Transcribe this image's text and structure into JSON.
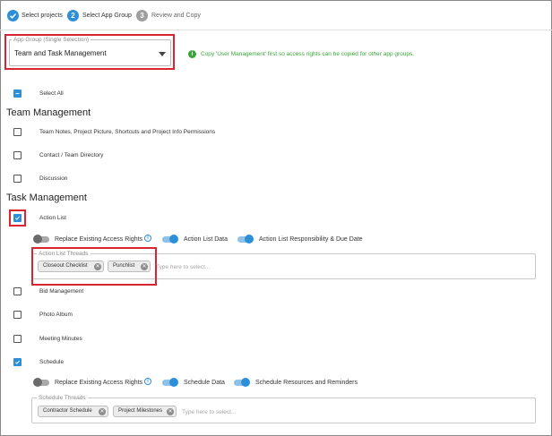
{
  "stepper": {
    "steps": [
      {
        "number": "1",
        "label": "Select projects",
        "state": "completed"
      },
      {
        "number": "2",
        "label": "Select App Group",
        "state": "active"
      },
      {
        "number": "3",
        "label": "Review and Copy",
        "state": "pending"
      }
    ]
  },
  "app_group": {
    "legend": "App Group (Single Selection)",
    "value": "Team and Task Management",
    "info_text": "Copy 'User Management' first so access rights can be copied for other app groups."
  },
  "select_all": {
    "label": "Select All",
    "state": "indeterminate"
  },
  "team_management": {
    "title": "Team Management",
    "items": [
      {
        "label": "Team Notes, Project Picture, Shortcuts and Project Info Permissions",
        "checked": false
      },
      {
        "label": "Contact / Team Directory",
        "checked": false
      },
      {
        "label": "Discussion",
        "checked": false
      }
    ]
  },
  "task_management": {
    "title": "Task Management",
    "action_list": {
      "label": "Action List",
      "checked": true,
      "options": [
        {
          "label": "Replace Existing Access Rights",
          "on": false,
          "has_info": true
        },
        {
          "label": "Action List Data",
          "on": true
        },
        {
          "label": "Action List Responsibility & Due Date",
          "on": true
        }
      ],
      "threads": {
        "legend": "Action List Threads",
        "chips": [
          "Closeout Checklist",
          "Punchlist"
        ],
        "placeholder": "Type here to select..."
      }
    },
    "items": [
      {
        "label": "Bid Management",
        "checked": false
      },
      {
        "label": "Photo Album",
        "checked": false
      },
      {
        "label": "Meeting Minutes",
        "checked": false
      }
    ],
    "schedule": {
      "label": "Schedule",
      "checked": true,
      "options": [
        {
          "label": "Replace Existing Access Rights",
          "on": false,
          "has_info": true
        },
        {
          "label": "Schedule Data",
          "on": true
        },
        {
          "label": "Schedule Resources and Reminders",
          "on": true
        }
      ],
      "threads": {
        "legend": "Schedule Threads",
        "chips": [
          "Contractor Schedule",
          "Project Milestones"
        ],
        "placeholder": "Type here to select..."
      }
    }
  },
  "colors": {
    "accent": "#2c8fd8",
    "highlight": "#d9252f",
    "success": "#3aa53a",
    "pending": "#9e9e9e"
  }
}
